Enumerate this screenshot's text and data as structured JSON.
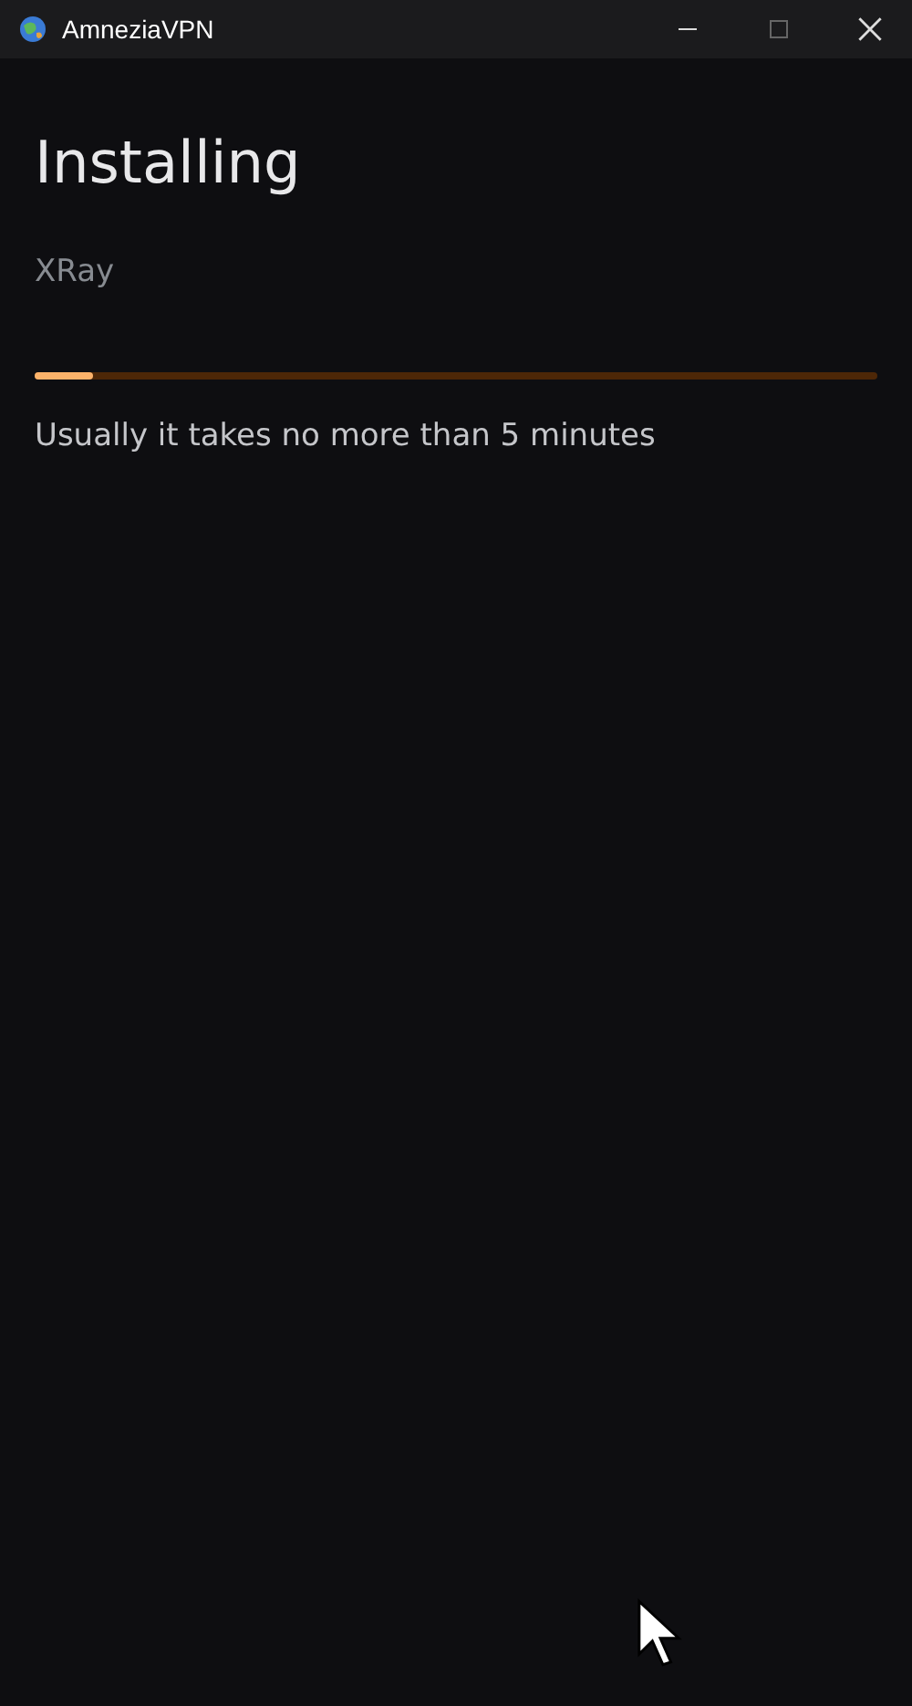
{
  "window": {
    "title": "AmneziaVPN"
  },
  "heading": "Installing",
  "protocol": "XRay",
  "progress": {
    "level": 0.07
  },
  "hint": "Usually it takes no more than 5 minutes"
}
